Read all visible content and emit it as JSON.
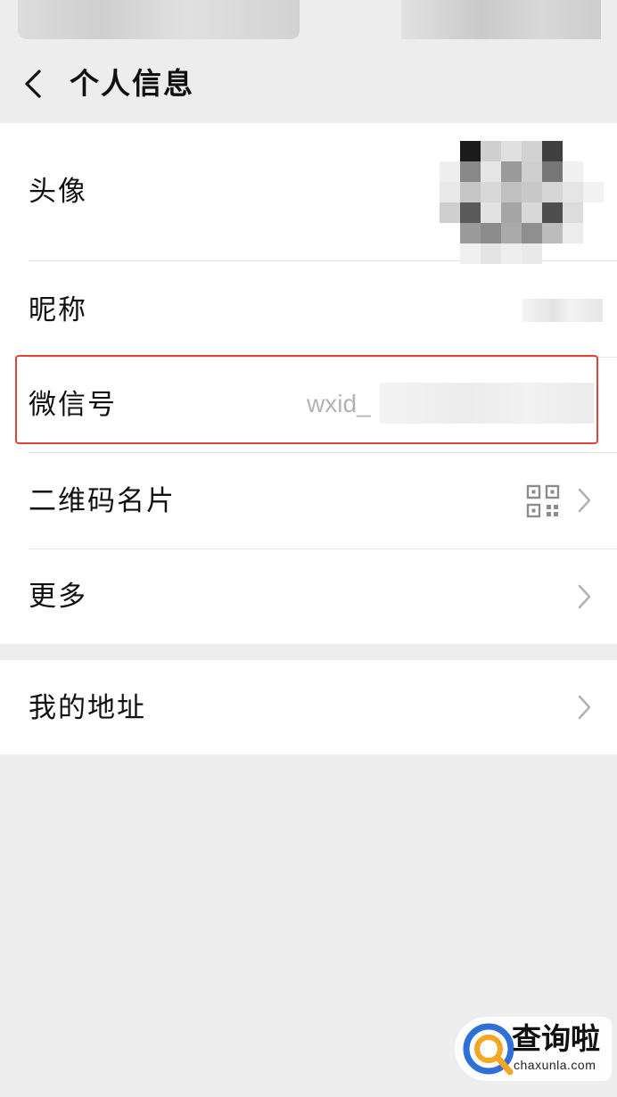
{
  "nav": {
    "title": "个人信息",
    "back_icon": "chevron-left-icon"
  },
  "profile": {
    "avatar_label": "头像",
    "nickname_label": "昵称",
    "wechat_id_label": "微信号",
    "wechat_id_value": "wxid_",
    "qr_card_label": "二维码名片",
    "more_label": "更多",
    "address_label": "我的地址"
  },
  "icons": {
    "qr": "qr-code-icon",
    "chevron": "chevron-right-icon"
  },
  "colors": {
    "highlight": "#e0423c",
    "background": "#ededed"
  },
  "watermark": {
    "name": "查询啦",
    "url": "chaxunla.com"
  }
}
